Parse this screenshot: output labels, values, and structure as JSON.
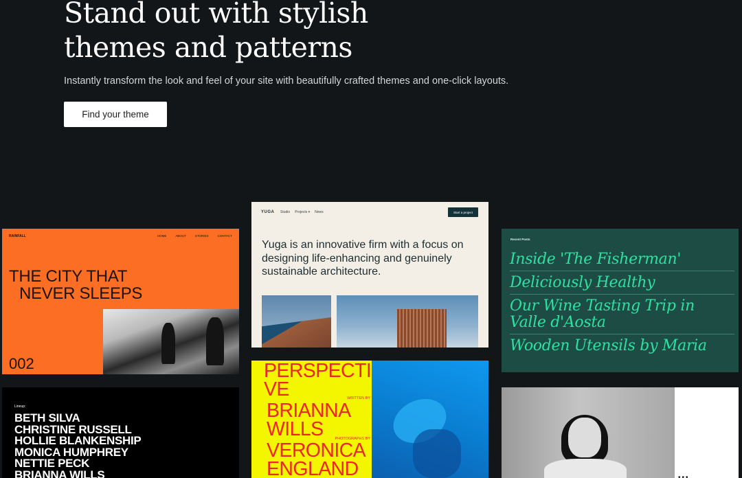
{
  "hero": {
    "title_line1": "Stand out with stylish",
    "title_line2": "themes and patterns",
    "subtitle": "Instantly transform the look and feel of your site with beautifully crafted themes and one-click layouts.",
    "cta_label": "Find your theme"
  },
  "rainfall": {
    "brand": "RAINFALL",
    "nav": [
      "HOME",
      "ABOUT",
      "STORIES",
      "CONTACT"
    ],
    "heading_line1": "THE CITY THAT",
    "heading_line2": "NEVER SLEEPS",
    "number": "002"
  },
  "yuga": {
    "brand": "YUGA",
    "nav": [
      "Studio",
      "Projects ▾",
      "News"
    ],
    "cta": "Start a project",
    "heading": "Yuga is an innovative firm with a focus on designing life-enhancing and genuinely sustainable architecture."
  },
  "posts": {
    "label": "Recent Posts",
    "items": [
      "Inside 'The Fisherman'",
      "Deliciously Healthy",
      "Our Wine Tasting Trip in Valle d'Aosta",
      "Wooden Utensils by Maria"
    ]
  },
  "lineup": {
    "label": "Lineup:",
    "names": [
      "BETH SILVA",
      "CHRISTINE RUSSELL",
      "HOLLIE BLANKENSHIP",
      "MONICA HUMPHREY",
      "NETTIE PECK",
      "BRIANNA WILLS"
    ]
  },
  "perspective": {
    "title_line1": "PERSPECTI",
    "title_line2": "VE",
    "written_by": "WRITTEN BY",
    "author": "BRIANNA WILLS",
    "photos_by": "PHOTOGRAPHS BY",
    "photographer": "VERONICA ENGLAND"
  },
  "portrait": {
    "dots": "•••"
  },
  "colors": {
    "background": "#131618",
    "rainfall": "#fb6e23",
    "yuga": "#f3efe6",
    "posts": "#1c4c44",
    "posts_text": "#2ee0a2",
    "perspective_yellow": "#f4f600",
    "perspective_red": "#ec2525",
    "perspective_blue": "#0a8ee6"
  }
}
